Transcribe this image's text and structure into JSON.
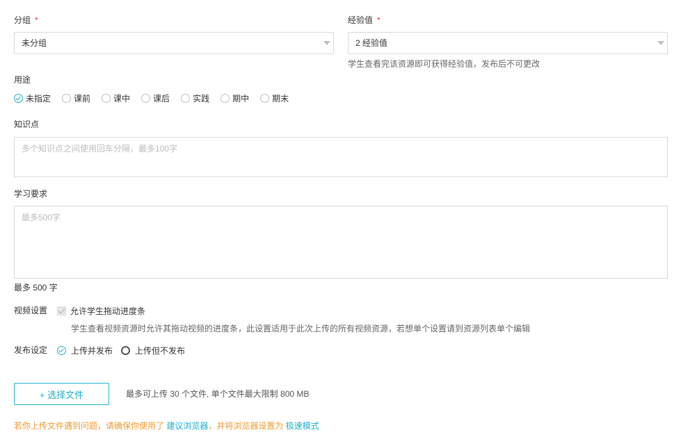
{
  "group": {
    "label": "分组",
    "required_mark": "*",
    "value": "未分组"
  },
  "experience": {
    "label": "经验值",
    "required_mark": "*",
    "value": "2 经验值",
    "hint": "学生查看完该资源即可获得经验值，发布后不可更改"
  },
  "usage": {
    "label": "用途",
    "options": [
      "未指定",
      "课前",
      "课中",
      "课后",
      "实践",
      "期中",
      "期末"
    ],
    "selected_index": 0
  },
  "knowledge": {
    "label": "知识点",
    "placeholder": "多个知识点之间使用回车分隔，最多100字"
  },
  "requirement": {
    "label": "学习要求",
    "placeholder": "最多500字",
    "limit_text": "最多 500 字"
  },
  "video": {
    "label": "视频设置",
    "checkbox_label": "允许学生拖动进度条",
    "description": "学生查看视频资源时允许其拖动视频的进度条，此设置适用于此次上传的所有视频资源，若想单个设置请到资源列表单个编辑"
  },
  "publish": {
    "label": "发布设定",
    "options": [
      "上传并发布",
      "上传但不发布"
    ],
    "selected_index": 0
  },
  "upload": {
    "button_label": "+ 选择文件",
    "limit_text": "最多可上传 30 个文件, 单个文件最大限制 800 MB"
  },
  "notice": {
    "prefix": "若你上传文件遇到问题，请确保你使用了",
    "link1": "建议浏览器",
    "middle": "，并将浏览器设置为",
    "link2": "极速模式"
  },
  "colors": {
    "accent": "#1fb0c9",
    "required": "#e4393c",
    "warning": "#f19a31"
  }
}
